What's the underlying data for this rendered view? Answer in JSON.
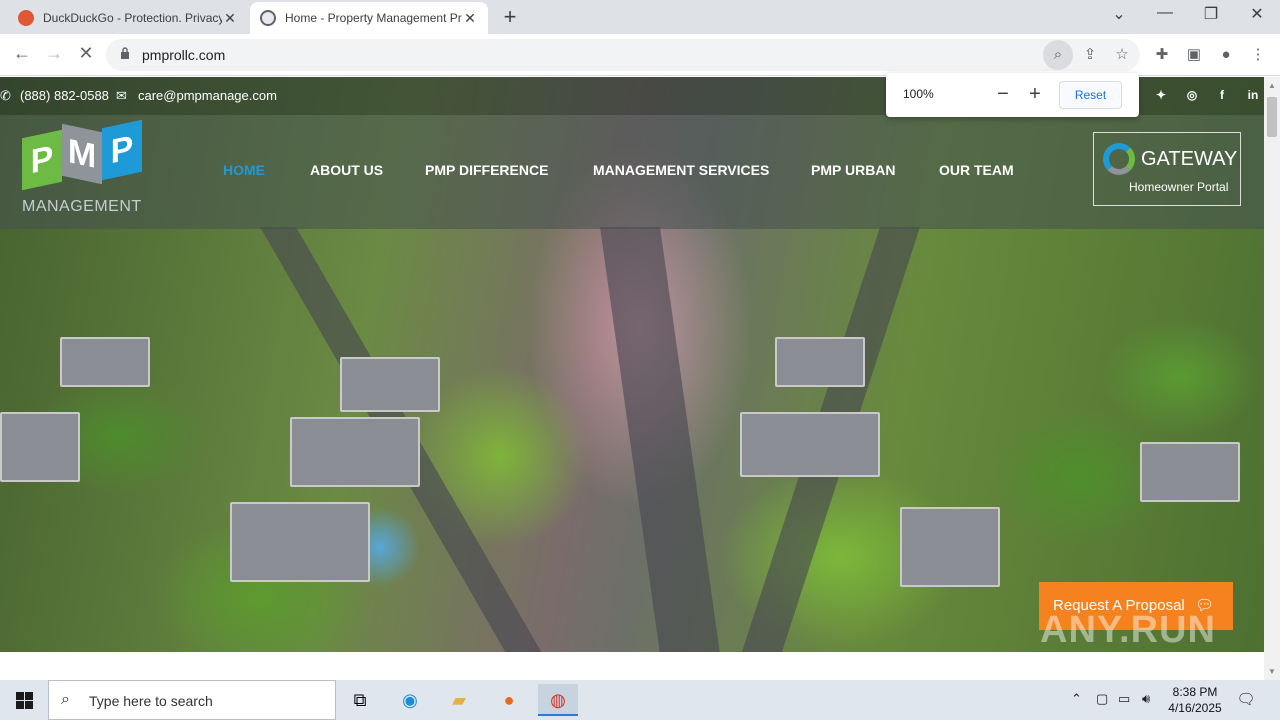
{
  "browser": {
    "tabs": [
      {
        "title": "DuckDuckGo - Protection. Privacy. Peace of mind.",
        "active": false
      },
      {
        "title": "Home - Property Management Professionals",
        "active": true
      }
    ],
    "url": "pmprollc.com",
    "zoom_popup": {
      "percent": "100%",
      "reset_label": "Reset"
    }
  },
  "site": {
    "topbar": {
      "phone": "(888) 882-0588",
      "email": "care@pmpmanage.com"
    },
    "logo": {
      "letters": [
        "P",
        "M",
        "P"
      ],
      "subtitle": "MANAGEMENT"
    },
    "nav": [
      {
        "label": "HOME",
        "active": true
      },
      {
        "label": "ABOUT US",
        "active": false
      },
      {
        "label": "PMP DIFFERENCE",
        "active": false
      },
      {
        "label": "MANAGEMENT SERVICES",
        "active": false
      },
      {
        "label": "PMP URBAN",
        "active": false
      },
      {
        "label": "OUR TEAM",
        "active": false
      }
    ],
    "gateway": {
      "title": "GATEWAY",
      "subtitle": "Homeowner Portal"
    },
    "cta": {
      "label": "Request A Proposal"
    },
    "watermark": "ANY.RUN"
  },
  "taskbar": {
    "search_placeholder": "Type here to search",
    "time": "8:38 PM",
    "date": "4/16/2025"
  },
  "colors": {
    "accent_blue": "#1e9bd7",
    "logo_green": "#6dbb44",
    "cta_orange": "#f5821f"
  }
}
